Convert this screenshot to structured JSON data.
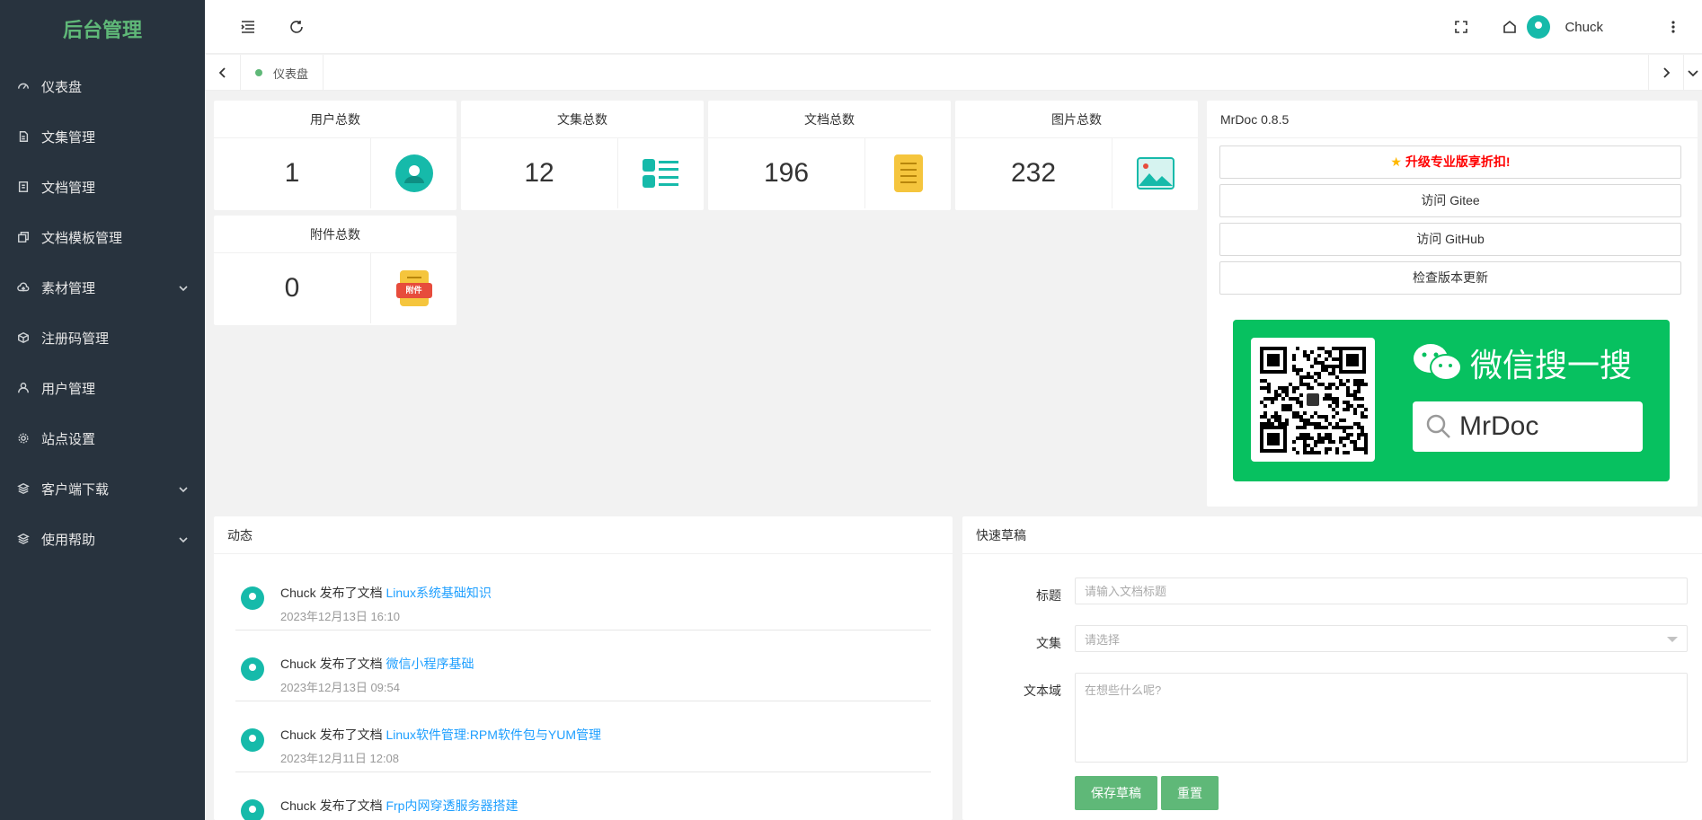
{
  "sidebar": {
    "brand": "后台管理",
    "items": [
      {
        "label": "仪表盘",
        "icon": "dashboard-icon"
      },
      {
        "label": "文集管理",
        "icon": "file-icon"
      },
      {
        "label": "文档管理",
        "icon": "document-icon"
      },
      {
        "label": "文档模板管理",
        "icon": "template-icon"
      },
      {
        "label": "素材管理",
        "icon": "cloud-icon",
        "expandable": true
      },
      {
        "label": "注册码管理",
        "icon": "box-icon"
      },
      {
        "label": "用户管理",
        "icon": "user-icon"
      },
      {
        "label": "站点设置",
        "icon": "gear-icon"
      },
      {
        "label": "客户端下载",
        "icon": "layers-icon",
        "expandable": true
      },
      {
        "label": "使用帮助",
        "icon": "layers-icon",
        "expandable": true
      }
    ]
  },
  "topbar": {
    "user_name": "Chuck"
  },
  "tabs": [
    {
      "label": "仪表盘",
      "active": true
    }
  ],
  "stats": [
    {
      "title": "用户总数",
      "value": "1",
      "icon": "user-avatar-icon"
    },
    {
      "title": "文集总数",
      "value": "12",
      "icon": "list-icon"
    },
    {
      "title": "文档总数",
      "value": "196",
      "icon": "document-icon"
    },
    {
      "title": "图片总数",
      "value": "232",
      "icon": "image-icon"
    },
    {
      "title": "附件总数",
      "value": "0",
      "icon": "attachment-icon",
      "icon_text": "附件"
    }
  ],
  "info_panel": {
    "title": "MrDoc 0.8.5",
    "buttons": [
      {
        "label": "升级专业版享折扣!",
        "style": "promo"
      },
      {
        "label": "访问 Gitee"
      },
      {
        "label": "访问 GitHub"
      },
      {
        "label": "检查版本更新"
      }
    ],
    "wechat": {
      "title": "微信搜一搜",
      "search_text": "MrDoc",
      "color": "#07c160"
    }
  },
  "activity": {
    "title": "动态",
    "items": [
      {
        "user": "Chuck",
        "action": "发布了文档",
        "doc": "Linux系统基础知识",
        "time": "2023年12月13日 16:10"
      },
      {
        "user": "Chuck",
        "action": "发布了文档",
        "doc": "微信小程序基础",
        "time": "2023年12月13日 09:54"
      },
      {
        "user": "Chuck",
        "action": "发布了文档",
        "doc": "Linux软件管理:RPM软件包与YUM管理",
        "time": "2023年12月11日 12:08"
      },
      {
        "user": "Chuck",
        "action": "发布了文档",
        "doc": "Frp内网穿透服务器搭建",
        "time": ""
      }
    ]
  },
  "draft": {
    "title": "快速草稿",
    "fields": {
      "title_label": "标题",
      "title_placeholder": "请输入文档标题",
      "project_label": "文集",
      "project_placeholder": "请选择",
      "content_label": "文本域",
      "content_placeholder": "在想些什么呢?"
    },
    "save_label": "保存草稿",
    "reset_label": "重置"
  },
  "colors": {
    "accent": "#5fb878",
    "teal": "#16baaa",
    "link": "#1e9fff",
    "sidebar_bg": "#28333e"
  }
}
